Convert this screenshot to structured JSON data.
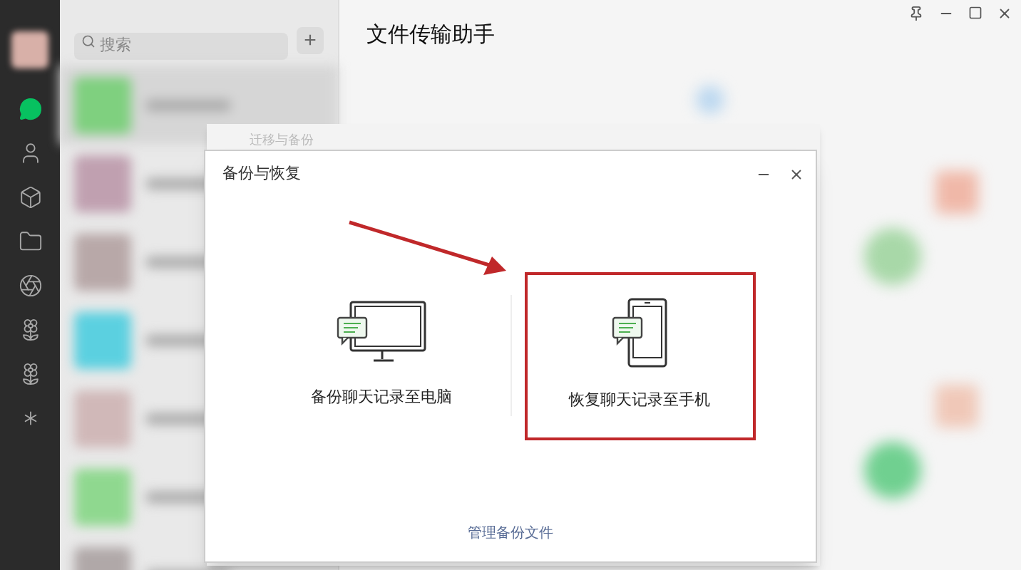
{
  "sidebar": {
    "items": [
      {
        "selected": true
      },
      {
        "selected": false
      },
      {
        "selected": false
      },
      {
        "selected": false
      },
      {
        "selected": false
      },
      {
        "selected": false
      },
      {
        "selected": false
      },
      {
        "selected": false
      }
    ]
  },
  "chat_list": {
    "search": {
      "placeholder": "搜索"
    },
    "add_button": "+"
  },
  "chat": {
    "title": "文件传输助手"
  },
  "back_dialog": {
    "title": "迁移与备份"
  },
  "dialog": {
    "title": "备份与恢复",
    "options": [
      {
        "kind": "computer",
        "label": "备份聊天记录至电脑",
        "highlighted": false
      },
      {
        "kind": "phone",
        "label": "恢复聊天记录至手机",
        "highlighted": true
      }
    ],
    "link": "管理备份文件"
  }
}
